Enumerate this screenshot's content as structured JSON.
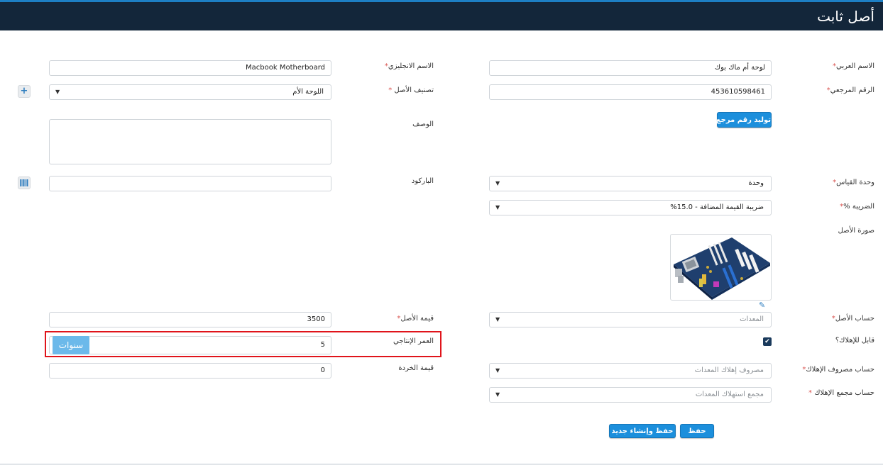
{
  "header": {
    "title": "أصل ثابت"
  },
  "fields": {
    "arabic_name": {
      "label": "الاسم العربي",
      "value": "لوحة أم ماك بوك"
    },
    "english_name": {
      "label": "الاسم الانجليزي",
      "value": "Macbook Motherboard"
    },
    "reference_no": {
      "label": "الرقم المرجعي",
      "value": "453610598461"
    },
    "asset_category": {
      "label": "تصنيف الأصل",
      "value": "اللوحة الأم"
    },
    "description": {
      "label": "الوصف",
      "value": ""
    },
    "barcode": {
      "label": "الباركود",
      "value": ""
    },
    "unit": {
      "label": "وحدة القياس",
      "value": "وحدة"
    },
    "tax": {
      "label": "الضريبة %",
      "value": "ضريبة القيمة المضافة - 15.0%"
    },
    "asset_image": {
      "label": "صورة الأصل"
    },
    "asset_account": {
      "label": "حساب الأصل",
      "value": "المعدات"
    },
    "asset_value": {
      "label": "قيمة الأصل",
      "value": "3500"
    },
    "depreciable": {
      "label": "قابل للإهلاك؟",
      "checked": true
    },
    "useful_life": {
      "label": "العمر الإنتاجي",
      "value": "5",
      "unit": "سنوات"
    },
    "depr_expense_account": {
      "label": "حساب مصروف الإهلاك",
      "value": "مصروف إهلاك المعدات"
    },
    "scrap_value": {
      "label": "قيمة الخردة",
      "value": "0"
    },
    "accum_depr_account": {
      "label": "حساب مجمع الإهلاك",
      "value": "مجمع استهلاك المعدات"
    }
  },
  "required_mark": "*",
  "buttons": {
    "generate_ref": "توليد رقم مرجع",
    "save": "حفظ",
    "save_and_new": "حفظ وإنشاء جديد",
    "add_category": "+"
  },
  "icons": {
    "barcode": "barcode-icon",
    "edit": "pencil-icon",
    "caret": "caret-down-icon"
  },
  "colors": {
    "header_bg": "#13263a",
    "accent": "#1c8fdc",
    "highlight": "#e0141b"
  }
}
